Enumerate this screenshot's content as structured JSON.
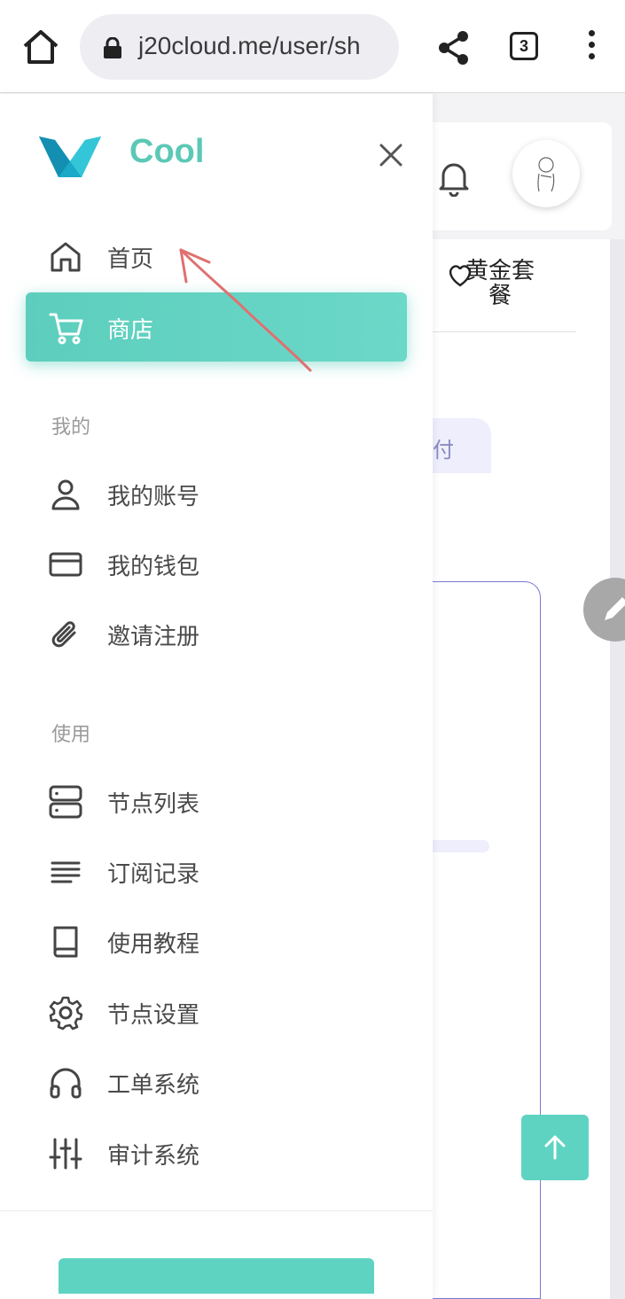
{
  "browser": {
    "url": "j20cloud.me/user/sh",
    "tab_count": "3"
  },
  "drawer": {
    "brand": "Cool",
    "primary_nav": [
      {
        "label": "首页",
        "icon": "home-icon",
        "active": false
      },
      {
        "label": "商店",
        "icon": "cart-icon",
        "active": true
      }
    ],
    "sections": [
      {
        "title": "我的",
        "items": [
          {
            "label": "我的账号",
            "icon": "user-icon"
          },
          {
            "label": "我的钱包",
            "icon": "credit-card-icon"
          },
          {
            "label": "邀请注册",
            "icon": "paperclip-icon"
          }
        ]
      },
      {
        "title": "使用",
        "items": [
          {
            "label": "节点列表",
            "icon": "server-icon"
          },
          {
            "label": "订阅记录",
            "icon": "text-lines-icon"
          },
          {
            "label": "使用教程",
            "icon": "book-icon"
          },
          {
            "label": "节点设置",
            "icon": "gear-icon"
          },
          {
            "label": "工单系统",
            "icon": "headphones-icon"
          },
          {
            "label": "审计系统",
            "icon": "sliders-icon"
          }
        ]
      }
    ]
  },
  "background_page": {
    "plan_tab_label": "黄金套餐",
    "pay_chip_text": "付"
  },
  "colors": {
    "accent": "#5dcebd",
    "brand_text": "#5cc8b6",
    "annotation": "#e07070"
  }
}
